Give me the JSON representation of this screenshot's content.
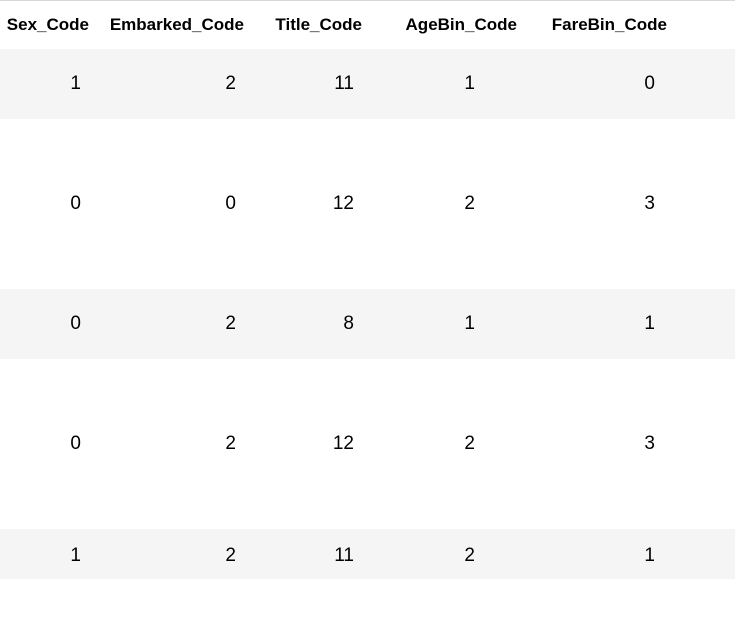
{
  "table": {
    "headers": {
      "sex": "Sex_Code",
      "embarked": "Embarked_Code",
      "title": "Title_Code",
      "agebin": "AgeBin_Code",
      "farebin": "FareBin_Code"
    },
    "rows": [
      {
        "sex": "1",
        "embarked": "2",
        "title": "11",
        "agebin": "1",
        "farebin": "0"
      },
      {
        "sex": "0",
        "embarked": "0",
        "title": "12",
        "agebin": "2",
        "farebin": "3"
      },
      {
        "sex": "0",
        "embarked": "2",
        "title": "8",
        "agebin": "1",
        "farebin": "1"
      },
      {
        "sex": "0",
        "embarked": "2",
        "title": "12",
        "agebin": "2",
        "farebin": "3"
      },
      {
        "sex": "1",
        "embarked": "2",
        "title": "11",
        "agebin": "2",
        "farebin": "1"
      }
    ]
  }
}
